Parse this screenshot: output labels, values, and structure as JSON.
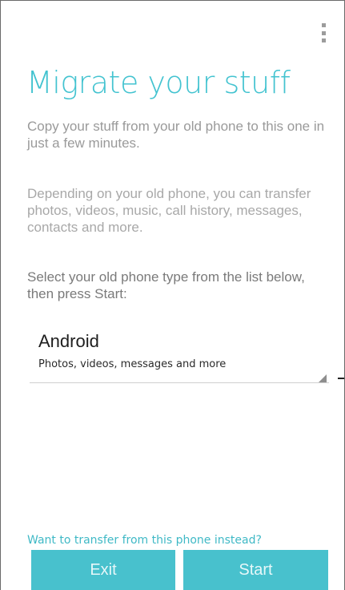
{
  "header": {
    "menu_icon": "overflow-menu-vertical-icon"
  },
  "main": {
    "title": "Migrate your stuff",
    "intro": "Copy your stuff from your old phone to this one in just a few minutes.",
    "details": "Depending on your old phone, you can transfer photos, videos, music, call history, messages, contacts and more.",
    "instruction": "Select your old phone type from the list below, then press Start:"
  },
  "phone_type_select": {
    "selected_label": "Android",
    "selected_description": "Photos, videos, messages and more"
  },
  "footer": {
    "transfer_link": "Want to transfer from this phone instead?",
    "exit_label": "Exit",
    "start_label": "Start"
  },
  "colors": {
    "accent": "#43c3d0",
    "button_bg": "#48c1cd",
    "secondary_text": "#9a9a9a"
  }
}
